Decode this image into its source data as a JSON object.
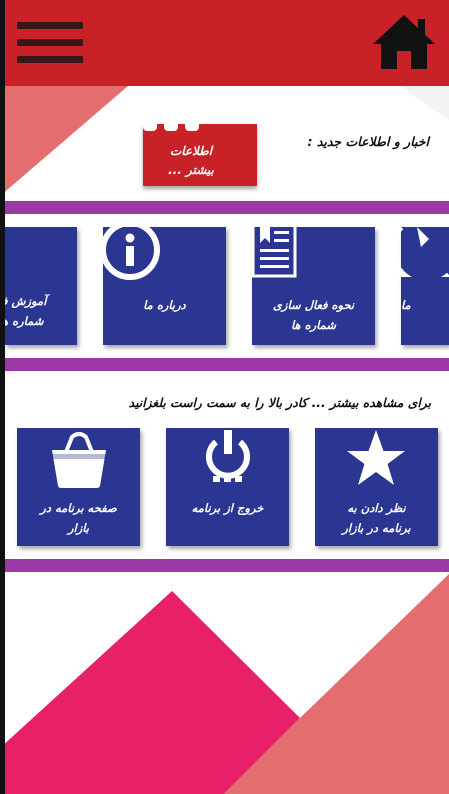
{
  "header": {
    "menu_icon": "hamburger-menu-icon",
    "home_icon": "home-icon"
  },
  "news": {
    "label": "اخبار و اطلاعات جدید :",
    "more_button_line1": "اطلاعات",
    "more_button_line2": "بیشتر ..."
  },
  "features_row": [
    {
      "label_line1": "آموزش ف",
      "label_line2": "شماره ها",
      "icon": "partial-tile"
    },
    {
      "label_line1": "درباره ما",
      "label_line2": "",
      "icon": "info-icon"
    },
    {
      "label_line1": "نحوه فعال سازی",
      "label_line2": "شماره ها",
      "icon": "document-icon"
    },
    {
      "label_line1": "ما",
      "label_line2": "",
      "icon": "phone-icon"
    }
  ],
  "hint": "برای مشاهده بیشتر ... کادر بالا را به سمت راست بلغزانید",
  "actions_row": [
    {
      "label_line1": "صفحه برنامه در",
      "label_line2": "بازار",
      "icon": "shopping-bag-icon"
    },
    {
      "label_line1": "خروج از برنامه",
      "label_line2": "",
      "icon": "power-icon"
    },
    {
      "label_line1": "نظر دادن به",
      "label_line2": "برنامه در بازار",
      "icon": "star-icon"
    }
  ],
  "colors": {
    "header_red": "#c82127",
    "tile_blue": "#2b3592",
    "divider_purple": "#9b3aa5",
    "deco_pink": "#e8206a",
    "deco_salmon": "#e46d6f"
  }
}
